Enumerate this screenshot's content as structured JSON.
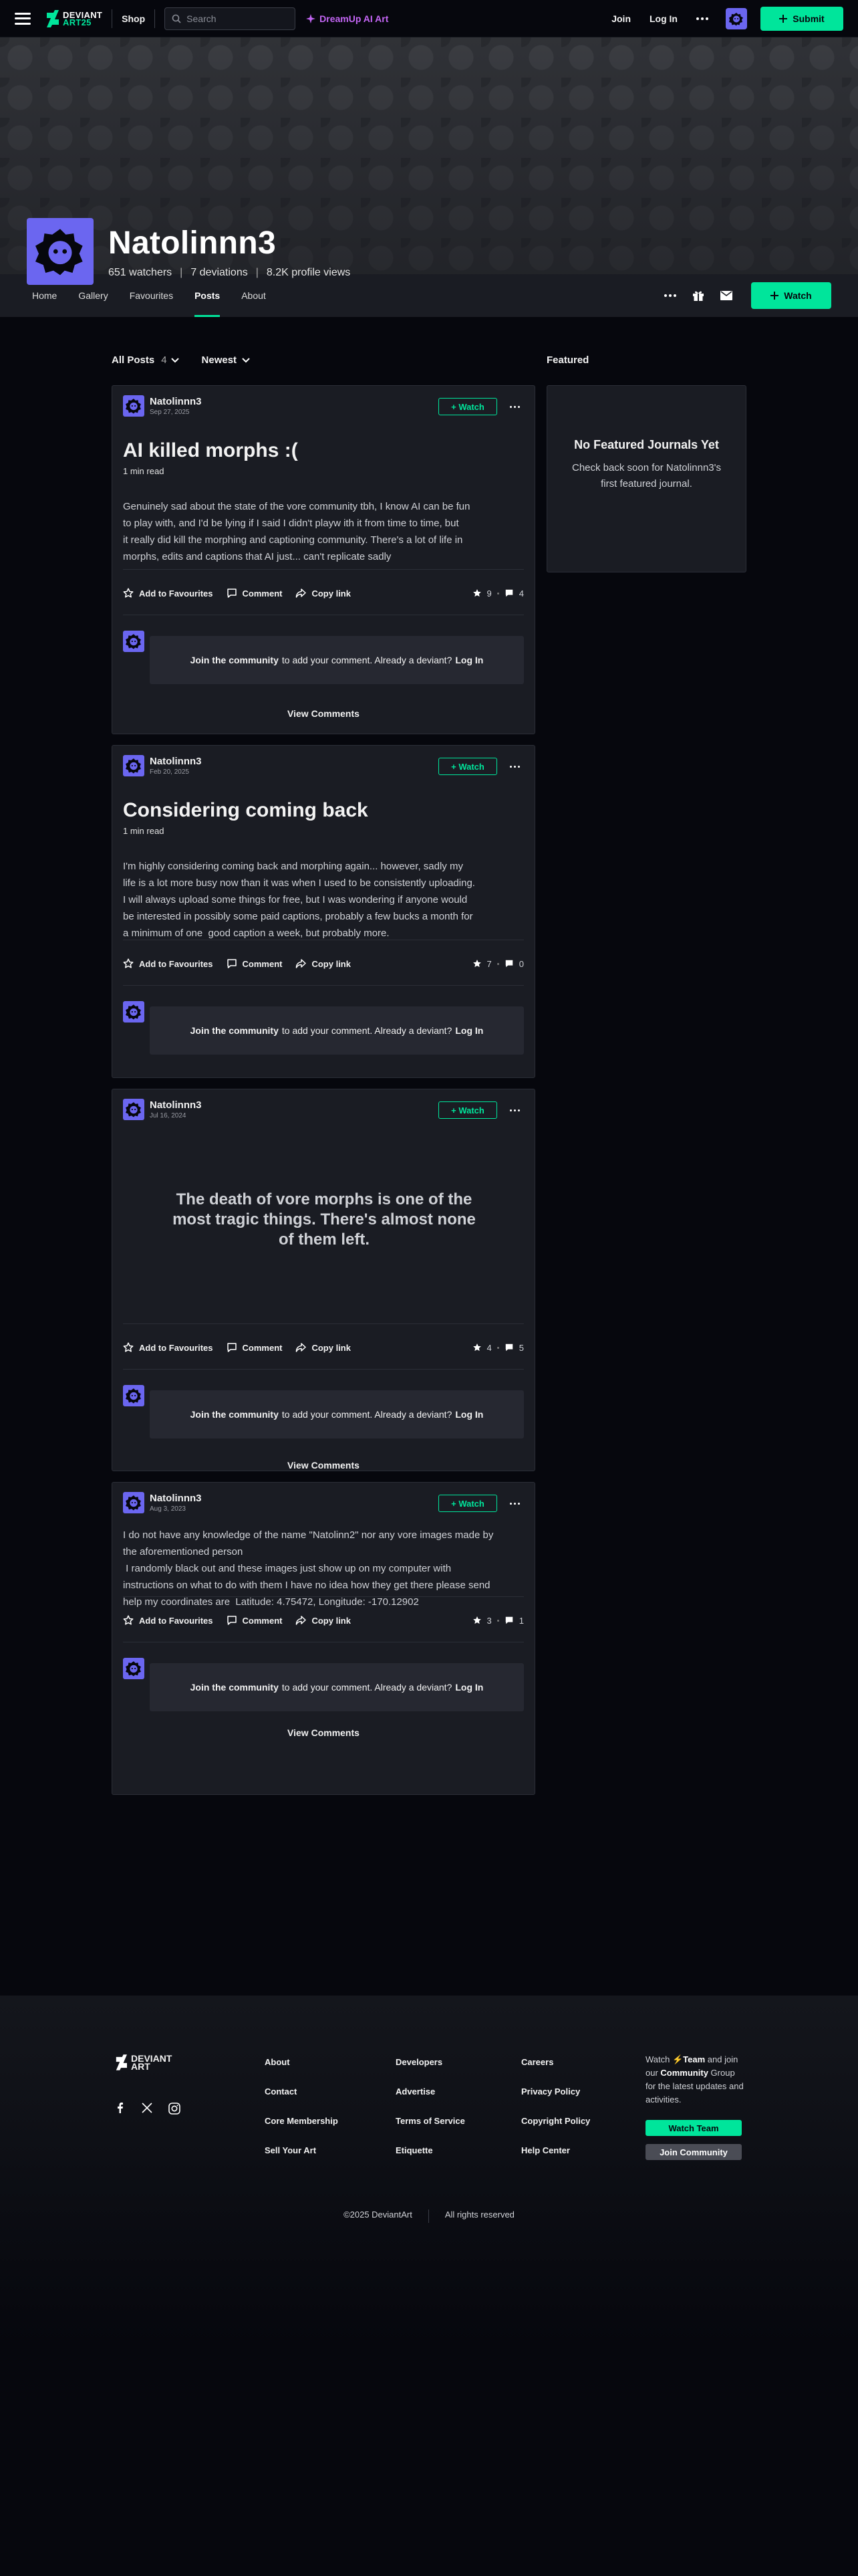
{
  "topnav": {
    "logo_line1": "DEVIANT",
    "logo_line2": "ART25",
    "shop": "Shop",
    "search_placeholder": "Search",
    "dreamup": "DreamUp AI Art",
    "join": "Join",
    "login": "Log In",
    "submit": "Submit"
  },
  "profile": {
    "name": "Natolinnn3",
    "watchers": "651 watchers",
    "deviations": "7 deviations",
    "views": "8.2K profile views"
  },
  "tabs": [
    {
      "label": "Home"
    },
    {
      "label": "Gallery"
    },
    {
      "label": "Favourites"
    },
    {
      "label": "Posts"
    },
    {
      "label": "About"
    }
  ],
  "watch_button": "Watch",
  "filters": {
    "all_posts": "All Posts",
    "count": "4",
    "sort": "Newest"
  },
  "featured": {
    "heading": "Featured",
    "title": "No Featured Journals Yet",
    "text": "Check back soon for Natolinnn3's first featured journal."
  },
  "card_ui": {
    "watch": "+ Watch",
    "add_fav": "Add to Favourites",
    "comment": "Comment",
    "copy_link": "Copy link",
    "join_bold": "Join the community",
    "join_rest": "to add your comment. Already a deviant?",
    "login": "Log In",
    "view_comments": "View Comments"
  },
  "posts": [
    {
      "author": "Natolinnn3",
      "date": "Sep 27, 2025",
      "title": "AI killed morphs :(",
      "read": "1 min read",
      "body": "Genuinely sad about the state of the vore community tbh, I know AI can be fun\nto play with, and I'd be lying if I said I didn't playw ith it from time to time, but\nit really did kill the morphing and captioning community. There's a lot of life in\nmorphs, edits and captions that AI just... can't replicate sadly",
      "favs": "9",
      "comments": "4"
    },
    {
      "author": "Natolinnn3",
      "date": "Feb 20, 2025",
      "title": "Considering coming back",
      "read": "1 min read",
      "body": "I'm highly considering coming back and morphing again... however, sadly my\nlife is a lot more busy now than it was when I used to be consistently uploading.\nI will always upload some things for free, but I was wondering if anyone would\nbe interested in possibly some paid captions, probably a few bucks a month for\na minimum of one  good caption a week, but probably more.",
      "favs": "7",
      "comments": "0"
    },
    {
      "author": "Natolinnn3",
      "date": "Jul 16, 2024",
      "quote": "The death of vore morphs is one of the most tragic things. There's almost none of them left.",
      "favs": "4",
      "comments": "5"
    },
    {
      "author": "Natolinnn3",
      "date": "Aug 3, 2023",
      "body": "I do not have any knowledge of the name \"Natolinn2\" nor any vore images made by\nthe aforementioned person\n I randomly black out and these images just show up on my computer with\ninstructions on what to do with them I have no idea how they get there please send\nhelp my coordinates are  Latitude: 4.75472, Longitude: -170.12902",
      "favs": "3",
      "comments": "1"
    }
  ],
  "footer": {
    "logo_line1": "DEVIANT",
    "logo_line2": "ART",
    "col1": [
      "About",
      "Contact",
      "Core Membership",
      "Sell Your Art"
    ],
    "col2": [
      "Developers",
      "Advertise",
      "Terms of Service",
      "Etiquette"
    ],
    "col3": [
      "Careers",
      "Privacy Policy",
      "Copyright Policy",
      "Help Center"
    ],
    "watch_text_1": "Watch",
    "watch_team": "Team",
    "watch_text_2": "and join our",
    "community": "Community",
    "watch_text_3": "Group for the latest updates and activities.",
    "watch_team_btn": "Watch Team",
    "join_community_btn": "Join Community",
    "copyright": "©2025 DeviantArt",
    "rights": "All rights reserved"
  },
  "colors": {
    "accent": "#00e59b",
    "avatar": "#6b66f0",
    "dreamup": "#c466f5"
  }
}
